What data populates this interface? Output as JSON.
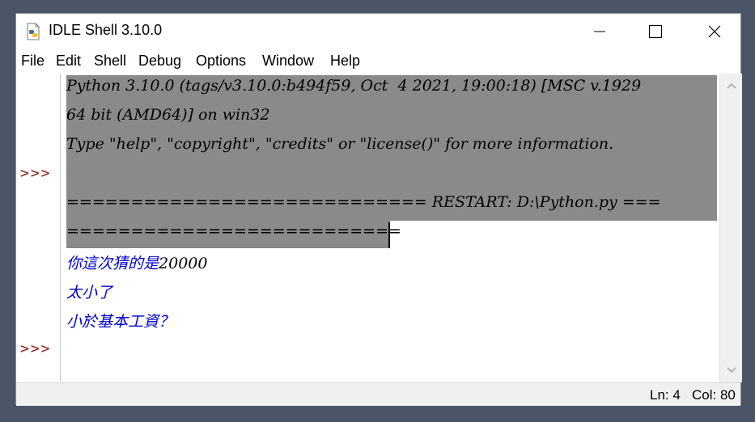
{
  "window": {
    "title": "IDLE Shell 3.10.0",
    "app_icon": "python-file-icon"
  },
  "menu": [
    "File",
    "Edit",
    "Shell",
    "Debug",
    "Options",
    "Window",
    "Help"
  ],
  "shell": {
    "prompt": ">>>",
    "banner": [
      "Python 3.10.0 (tags/v3.10.0:b494f59, Oct  4 2021, 19:00:18) [MSC v.1929",
      "64 bit (AMD64)] on win32",
      "Type \"help\", \"copyright\", \"credits\" or \"license()\" for more information."
    ],
    "restart": [
      "============================ RESTART: D:\\Python.py ===",
      "=========================="
    ],
    "input_prompt": "你這次猜的是",
    "input_value": "20000",
    "outputs": [
      "太小了",
      "小於基本工資？"
    ]
  },
  "status": {
    "line": "Ln: 4",
    "col": "Col: 80"
  },
  "colors": {
    "prompt": "#8b1a1a",
    "output": "#0000cc",
    "selection": "#8a8a8a"
  }
}
